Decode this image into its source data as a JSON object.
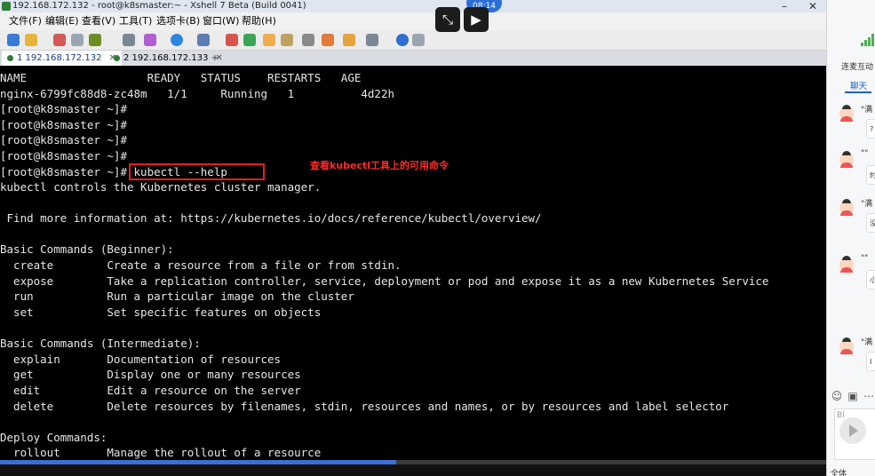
{
  "window": {
    "title": "192.168.172.132 - root@k8smaster:~ - Xshell 7 Beta (Build 0041)"
  },
  "menu": [
    "文件(F)",
    "编辑(E)",
    "查看(V)",
    "工具(T)",
    "选项卡(B)",
    "窗口(W)",
    "帮助(H)"
  ],
  "tabs": [
    {
      "label": "1 192.168.172.132",
      "active": true,
      "status_color": "#2e7d32"
    },
    {
      "label": "2 192.168.172.133",
      "active": false,
      "status_color": "#2e7d32"
    }
  ],
  "terminal": {
    "lines": [
      "NAME                  READY   STATUS    RESTARTS   AGE",
      "nginx-6799fc88d8-zc48m   1/1     Running   1          4d22h",
      "[root@k8smaster ~]#",
      "[root@k8smaster ~]#",
      "[root@k8smaster ~]#",
      "[root@k8smaster ~]#",
      "[root@k8smaster ~]# kubectl --help",
      "kubectl controls the Kubernetes cluster manager.",
      "",
      " Find more information at: https://kubernetes.io/docs/reference/kubectl/overview/",
      "",
      "Basic Commands (Beginner):",
      "  create        Create a resource from a file or from stdin.",
      "  expose        Take a replication controller, service, deployment or pod and expose it as a new Kubernetes Service",
      "  run           Run a particular image on the cluster",
      "  set           Set specific features on objects",
      "",
      "Basic Commands (Intermediate):",
      "  explain       Documentation of resources",
      "  get           Display one or many resources",
      "  edit          Edit a resource on the server",
      "  delete        Delete resources by filenames, stdin, resources and names, or by resources and label selector",
      "",
      "Deploy Commands:",
      "  rollout       Manage the rollout of a resource"
    ],
    "annotation": "查看kubectl工具上的可用命令",
    "text_color": "#e6e6e6",
    "highlight_color": "#e02020"
  },
  "video": {
    "time": "08:14",
    "progress": 0.48
  },
  "side_panel": {
    "tab_top": "连麦互动",
    "tab_chat": "聊天",
    "messages": [
      {
        "name": "\"满",
        "text": "?"
      },
      {
        "name": "\"\"",
        "text": "时"
      },
      {
        "name": "\"满",
        "text": "没"
      },
      {
        "name": "\"\"",
        "text": "小"
      },
      {
        "name": "\"满",
        "text": "I"
      }
    ],
    "input_hint": "Bl",
    "bottom_label": "全体"
  }
}
